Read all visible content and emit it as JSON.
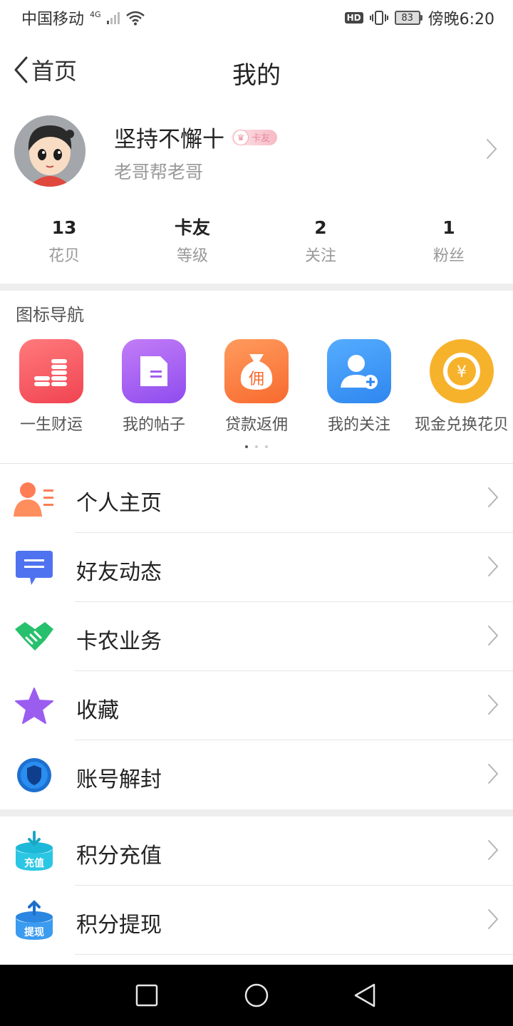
{
  "status_bar": {
    "carrier": "中国移动",
    "network": "4G",
    "hd": "HD",
    "battery": "83",
    "time": "傍晚6:20"
  },
  "navbar": {
    "back_label": "首页",
    "title": "我的"
  },
  "profile": {
    "username": "坚持不懈十",
    "level_badge": "卡友",
    "signature": "老哥帮老哥"
  },
  "stats": [
    {
      "value": "13",
      "label": "花贝"
    },
    {
      "value": "卡友",
      "label": "等级"
    },
    {
      "value": "2",
      "label": "关注"
    },
    {
      "value": "1",
      "label": "粉丝"
    }
  ],
  "icon_nav": {
    "title": "图标导航",
    "items": [
      {
        "label": "一生财运",
        "icon": "coins-stack-icon",
        "color": "#f5585e"
      },
      {
        "label": "我的帖子",
        "icon": "document-icon",
        "color": "#a15ff0"
      },
      {
        "label": "贷款返佣",
        "icon": "money-bag-icon",
        "color": "#fb7337"
      },
      {
        "label": "我的关注",
        "icon": "add-user-icon",
        "color": "#3a95f7"
      },
      {
        "label": "现金兑换花贝",
        "icon": "yuan-coin-icon",
        "color": "#f7b22c"
      }
    ],
    "pager": {
      "pages": 3,
      "active": 1
    }
  },
  "menu_group_1": [
    {
      "label": "个人主页",
      "icon": "person-profile-icon"
    },
    {
      "label": "好友动态",
      "icon": "chat-bubble-icon"
    },
    {
      "label": "卡农业务",
      "icon": "handshake-icon"
    },
    {
      "label": "收藏",
      "icon": "star-icon"
    },
    {
      "label": "账号解封",
      "icon": "shield-icon"
    }
  ],
  "menu_group_2": [
    {
      "label": "积分充值",
      "icon": "recharge-icon",
      "icon_text": "充值"
    },
    {
      "label": "积分提现",
      "icon": "withdraw-icon",
      "icon_text": "提现"
    }
  ]
}
